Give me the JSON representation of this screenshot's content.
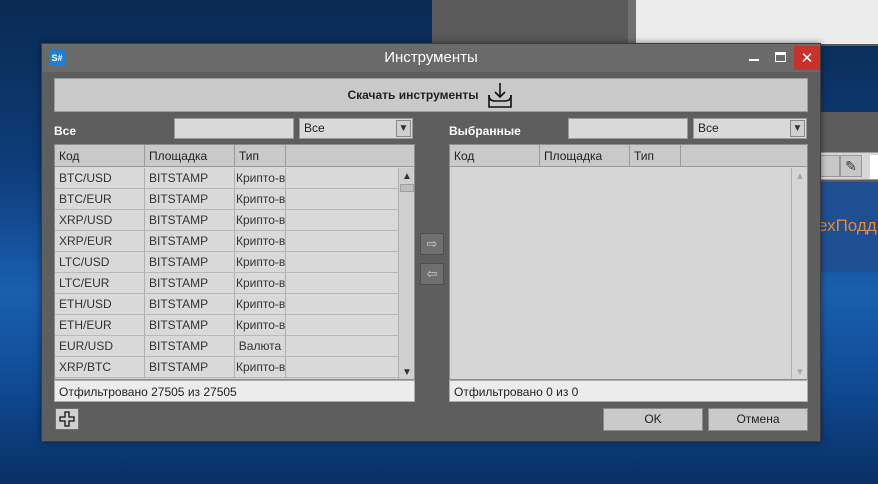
{
  "dialog": {
    "title": "Инструменты",
    "app_icon_label": "S#",
    "download_label": "Скачать инструменты",
    "minimize_glyph": "▬",
    "maximize_glyph": "☐",
    "close_glyph": "✕"
  },
  "left": {
    "label": "Все",
    "filter_value": "Все",
    "columns": [
      "Код",
      "Площадка",
      "Тип"
    ],
    "rows": [
      {
        "code": "BTC/USD",
        "board": "BITSTAMP",
        "type": "Крипто-в"
      },
      {
        "code": "BTC/EUR",
        "board": "BITSTAMP",
        "type": "Крипто-в"
      },
      {
        "code": "XRP/USD",
        "board": "BITSTAMP",
        "type": "Крипто-в"
      },
      {
        "code": "XRP/EUR",
        "board": "BITSTAMP",
        "type": "Крипто-в"
      },
      {
        "code": "LTC/USD",
        "board": "BITSTAMP",
        "type": "Крипто-в"
      },
      {
        "code": "LTC/EUR",
        "board": "BITSTAMP",
        "type": "Крипто-в"
      },
      {
        "code": "ETH/USD",
        "board": "BITSTAMP",
        "type": "Крипто-в"
      },
      {
        "code": "ETH/EUR",
        "board": "BITSTAMP",
        "type": "Крипто-в"
      },
      {
        "code": "EUR/USD",
        "board": "BITSTAMP",
        "type": "Валюта"
      },
      {
        "code": "XRP/BTC",
        "board": "BITSTAMP",
        "type": "Крипто-в"
      }
    ],
    "status": "Отфильтровано 27505 из 27505"
  },
  "right": {
    "label": "Выбранные",
    "filter_value": "Все",
    "columns": [
      "Код",
      "Площадка",
      "Тип"
    ],
    "status": "Отфильтровано 0 из 0"
  },
  "move_right_glyph": "⇨",
  "move_left_glyph": "⇦",
  "ok_label": "OK",
  "cancel_label": "Отмена",
  "background": {
    "orange_text": "ехПодд"
  },
  "colors": {
    "accent_close": "#c8322d",
    "app_icon": "#1e7fd4",
    "orange": "#f08a24"
  }
}
